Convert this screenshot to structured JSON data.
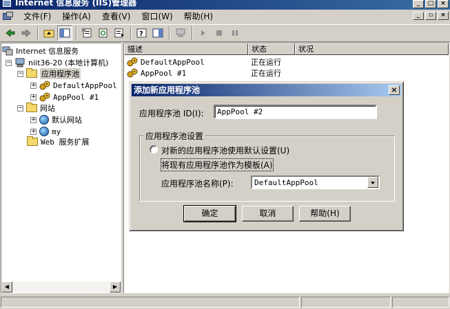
{
  "window": {
    "title": "Internet 信息服务 (IIS)管理器"
  },
  "menu": {
    "items": [
      "文件(F)",
      "操作(A)",
      "查看(V)",
      "窗口(W)",
      "帮助(H)"
    ]
  },
  "tree": {
    "root": "Internet 信息服务",
    "computer": "niit36-20 (本地计算机)",
    "app_pools": "应用程序池",
    "pool1": "DefaultAppPool",
    "pool2": "AppPool #1",
    "sites": "网站",
    "site1": "默认网站",
    "site2": "my",
    "web_ext": "Web 服务扩展"
  },
  "list": {
    "columns": [
      "描述",
      "状态",
      "状况"
    ],
    "rows": [
      {
        "name": "DefaultAppPool",
        "status": "正在运行",
        "state": ""
      },
      {
        "name": "AppPool #1",
        "status": "正在运行",
        "state": ""
      }
    ]
  },
  "dialog": {
    "title": "添加新应用程序池",
    "pool_id_label": "应用程序池 ID(I):",
    "pool_id_value": "AppPool #2",
    "group_label": "应用程序池设置",
    "radio_default": "对新的应用程序池使用默认设置(U)",
    "radio_template": "将现有应用程序池作为模板(A)",
    "pool_name_label": "应用程序池名称(P):",
    "pool_name_value": "DefaultAppPool",
    "ok": "确定",
    "cancel": "取消",
    "help": "帮助(H)"
  },
  "colors": {
    "title_blue": "#0a246a",
    "face": "#d4d0c8"
  }
}
